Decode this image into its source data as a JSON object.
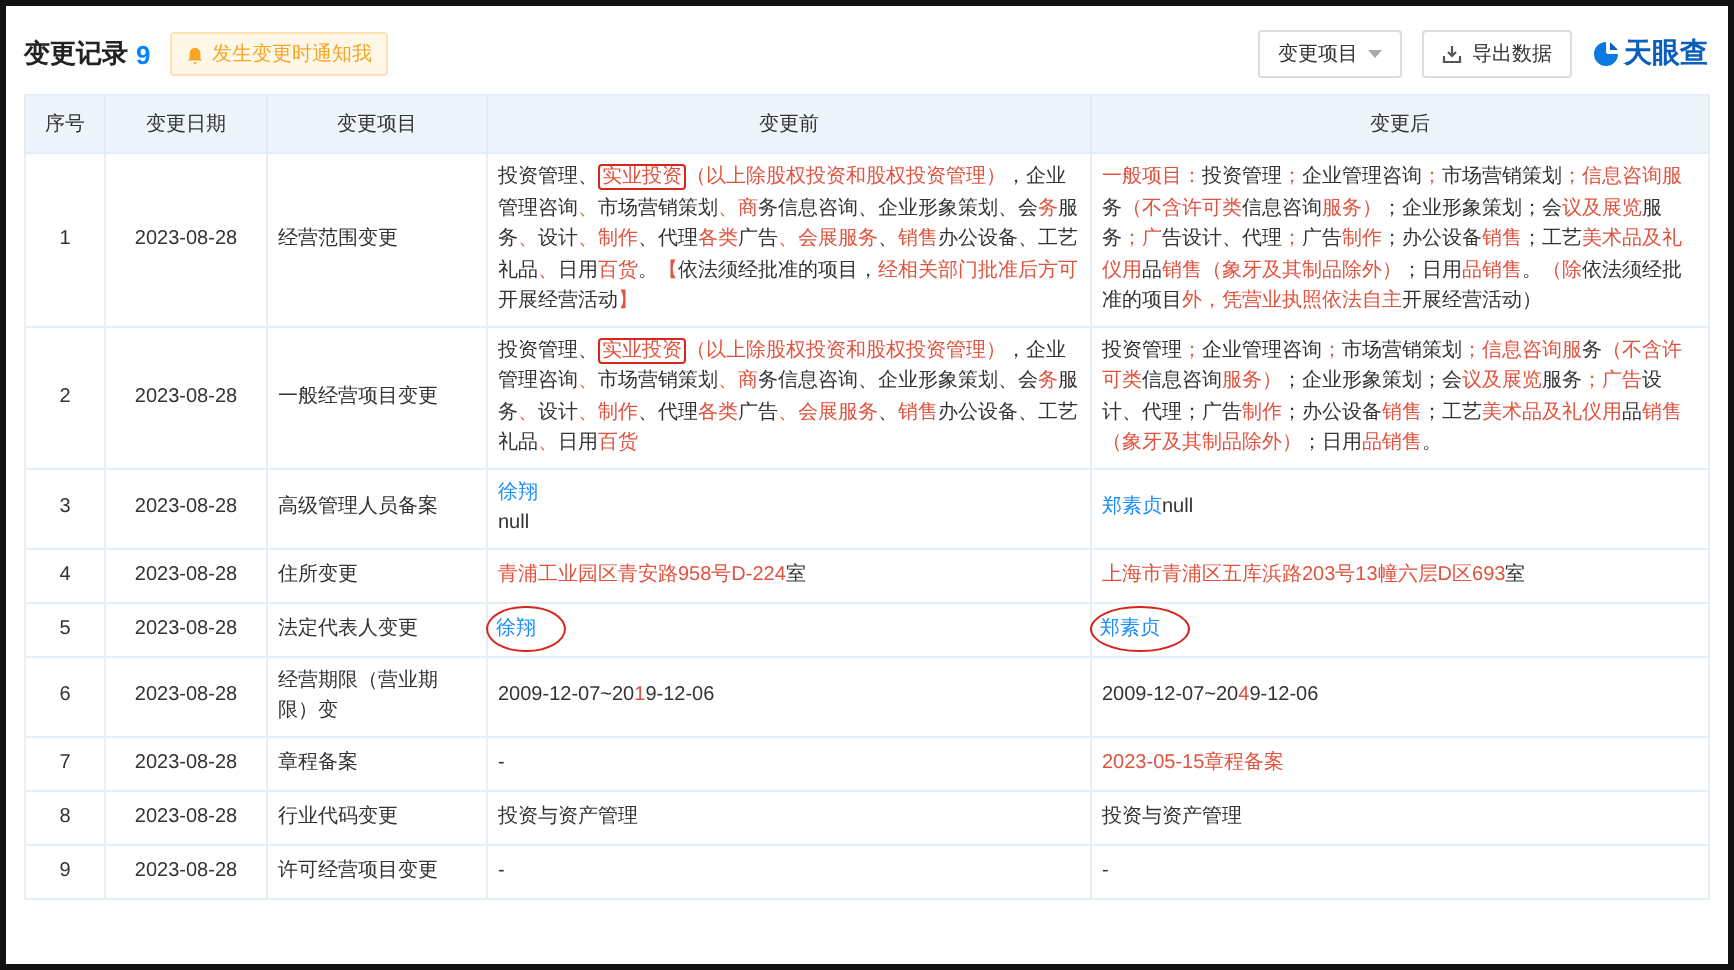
{
  "header": {
    "title": "变更记录",
    "count": "9",
    "notify_button": "发生变更时通知我",
    "filter_dropdown": "变更项目",
    "export_button": "导出数据",
    "logo": "天眼查"
  },
  "table": {
    "columns": [
      "序号",
      "变更日期",
      "变更项目",
      "变更前",
      "变更后"
    ],
    "rows": [
      {
        "index": "1",
        "date": "2023-08-28",
        "item": "经营范围变更",
        "before": [
          [
            {
              "text": "投资管理、",
              "kind": "plain"
            },
            {
              "text": "实业投资",
              "kind": "boxed"
            },
            {
              "text": "（以上除股权投资和股权投资管理）",
              "kind": "diff"
            },
            {
              "text": "，企业管理咨询",
              "kind": "plain"
            },
            {
              "text": "、",
              "kind": "diff"
            },
            {
              "text": "市场营销策划",
              "kind": "plain"
            },
            {
              "text": "、",
              "kind": "diff"
            },
            {
              "text": "商",
              "kind": "diff"
            },
            {
              "text": "务信息咨询、企业形象策划、会",
              "kind": "plain"
            },
            {
              "text": "务",
              "kind": "diff"
            },
            {
              "text": "服务",
              "kind": "plain"
            },
            {
              "text": "、",
              "kind": "diff"
            },
            {
              "text": "设计",
              "kind": "plain"
            },
            {
              "text": "、制作",
              "kind": "diff"
            },
            {
              "text": "、代理",
              "kind": "plain"
            },
            {
              "text": "各类",
              "kind": "diff"
            },
            {
              "text": "广告",
              "kind": "plain"
            },
            {
              "text": "、会展服务",
              "kind": "diff"
            },
            {
              "text": "、",
              "kind": "plain"
            },
            {
              "text": "销售",
              "kind": "diff"
            },
            {
              "text": "办公设备、工艺礼品",
              "kind": "plain"
            },
            {
              "text": "、",
              "kind": "diff"
            },
            {
              "text": "日用",
              "kind": "plain"
            },
            {
              "text": "百货",
              "kind": "diff"
            },
            {
              "text": "。",
              "kind": "plain"
            },
            {
              "text": "【",
              "kind": "diff"
            },
            {
              "text": "依法须经批准的项目，",
              "kind": "plain"
            },
            {
              "text": "经相关部门批准后方可",
              "kind": "diff"
            },
            {
              "text": "开展经营活动",
              "kind": "plain"
            },
            {
              "text": "】",
              "kind": "diff"
            }
          ]
        ],
        "after": [
          [
            {
              "text": "一般项目：",
              "kind": "diff"
            },
            {
              "text": "投资管理",
              "kind": "plain"
            },
            {
              "text": "；",
              "kind": "diff"
            },
            {
              "text": "企业管理咨询",
              "kind": "plain"
            },
            {
              "text": "；",
              "kind": "diff"
            },
            {
              "text": "市场营销策划",
              "kind": "plain"
            },
            {
              "text": "；信息咨询服",
              "kind": "diff"
            },
            {
              "text": "务",
              "kind": "plain"
            },
            {
              "text": "（不含许可类",
              "kind": "diff"
            },
            {
              "text": "信息咨询",
              "kind": "plain"
            },
            {
              "text": "服务）",
              "kind": "diff"
            },
            {
              "text": "；企业形象策划；会",
              "kind": "plain"
            },
            {
              "text": "议及展览",
              "kind": "diff"
            },
            {
              "text": "服务",
              "kind": "plain"
            },
            {
              "text": "；广",
              "kind": "diff"
            },
            {
              "text": "告设计、代理",
              "kind": "plain"
            },
            {
              "text": "；",
              "kind": "diff"
            },
            {
              "text": "广告",
              "kind": "plain"
            },
            {
              "text": "制作",
              "kind": "diff"
            },
            {
              "text": "；办公设备",
              "kind": "plain"
            },
            {
              "text": "销售",
              "kind": "diff"
            },
            {
              "text": "；工艺",
              "kind": "plain"
            },
            {
              "text": "美术品及礼仪用",
              "kind": "diff"
            },
            {
              "text": "品",
              "kind": "plain"
            },
            {
              "text": "销售（象牙及其制品除外）",
              "kind": "diff"
            },
            {
              "text": "；日用",
              "kind": "plain"
            },
            {
              "text": "品销售",
              "kind": "diff"
            },
            {
              "text": "。",
              "kind": "plain"
            },
            {
              "text": "（除",
              "kind": "diff"
            },
            {
              "text": "依法须经批准的项目",
              "kind": "plain"
            },
            {
              "text": "外，凭营业执照依法自主",
              "kind": "diff"
            },
            {
              "text": "开展经营活动）",
              "kind": "plain"
            }
          ]
        ]
      },
      {
        "index": "2",
        "date": "2023-08-28",
        "item": "一般经营项目变更",
        "before": [
          [
            {
              "text": "投资管理、",
              "kind": "plain"
            },
            {
              "text": "实业投资",
              "kind": "boxed"
            },
            {
              "text": "（以上除股权投资和股权投资管理）",
              "kind": "diff"
            },
            {
              "text": "，企业管理咨询",
              "kind": "plain"
            },
            {
              "text": "、",
              "kind": "diff"
            },
            {
              "text": "市场营销策划",
              "kind": "plain"
            },
            {
              "text": "、",
              "kind": "diff"
            },
            {
              "text": "商",
              "kind": "diff"
            },
            {
              "text": "务信息咨询、企业形象策划、会",
              "kind": "plain"
            },
            {
              "text": "务",
              "kind": "diff"
            },
            {
              "text": "服务",
              "kind": "plain"
            },
            {
              "text": "、",
              "kind": "diff"
            },
            {
              "text": "设计",
              "kind": "plain"
            },
            {
              "text": "、制作",
              "kind": "diff"
            },
            {
              "text": "、代理",
              "kind": "plain"
            },
            {
              "text": "各类",
              "kind": "diff"
            },
            {
              "text": "广告",
              "kind": "plain"
            },
            {
              "text": "、会展服务",
              "kind": "diff"
            },
            {
              "text": "、",
              "kind": "plain"
            },
            {
              "text": "销售",
              "kind": "diff"
            },
            {
              "text": "办公设备、工艺礼品",
              "kind": "plain"
            },
            {
              "text": "、",
              "kind": "diff"
            },
            {
              "text": "日用",
              "kind": "plain"
            },
            {
              "text": "百货",
              "kind": "diff"
            }
          ]
        ],
        "after": [
          [
            {
              "text": "投资管理",
              "kind": "plain"
            },
            {
              "text": "；",
              "kind": "diff"
            },
            {
              "text": "企业管理咨询",
              "kind": "plain"
            },
            {
              "text": "；",
              "kind": "diff"
            },
            {
              "text": "市场营销策划",
              "kind": "plain"
            },
            {
              "text": "；信息咨询服",
              "kind": "diff"
            },
            {
              "text": "务",
              "kind": "plain"
            },
            {
              "text": "（不含许可类",
              "kind": "diff"
            },
            {
              "text": "信息咨询",
              "kind": "plain"
            },
            {
              "text": "服务）",
              "kind": "diff"
            },
            {
              "text": "；企业形象策划；会",
              "kind": "plain"
            },
            {
              "text": "议及展览",
              "kind": "diff"
            },
            {
              "text": "服务",
              "kind": "plain"
            },
            {
              "text": "；广告",
              "kind": "diff"
            },
            {
              "text": "设计、代理；广告",
              "kind": "plain"
            },
            {
              "text": "制作",
              "kind": "diff"
            },
            {
              "text": "；办公设备",
              "kind": "plain"
            },
            {
              "text": "销售",
              "kind": "diff"
            },
            {
              "text": "；工艺",
              "kind": "plain"
            },
            {
              "text": "美术品及礼仪用",
              "kind": "diff"
            },
            {
              "text": "品",
              "kind": "plain"
            },
            {
              "text": "销售（象牙及其制品除外）",
              "kind": "diff"
            },
            {
              "text": "；日用",
              "kind": "plain"
            },
            {
              "text": "品销售",
              "kind": "diff"
            },
            {
              "text": "。",
              "kind": "plain"
            }
          ]
        ]
      },
      {
        "index": "3",
        "date": "2023-08-28",
        "item": "高级管理人员备案",
        "before": [
          [
            {
              "text": "徐翔",
              "kind": "link",
              "circled": false
            }
          ],
          [
            {
              "text": "null",
              "kind": "plain"
            }
          ]
        ],
        "after": [
          [
            {
              "text": "郑素贞",
              "kind": "link",
              "circled": false
            },
            {
              "text": "null",
              "kind": "plain"
            }
          ]
        ]
      },
      {
        "index": "4",
        "date": "2023-08-28",
        "item": "住所变更",
        "before": [
          [
            {
              "text": "青浦工业园区青安路958号D-224",
              "kind": "diff"
            },
            {
              "text": "室",
              "kind": "plain"
            }
          ]
        ],
        "after": [
          [
            {
              "text": "上海市青浦区五库浜路203号13幢六层D区693",
              "kind": "diff"
            },
            {
              "text": "室",
              "kind": "plain"
            }
          ]
        ]
      },
      {
        "index": "5",
        "date": "2023-08-28",
        "item": "法定代表人变更",
        "before": [
          [
            {
              "text": "徐翔",
              "kind": "link",
              "circled": true
            }
          ]
        ],
        "after": [
          [
            {
              "text": "郑素贞",
              "kind": "link",
              "circled": true
            }
          ]
        ]
      },
      {
        "index": "6",
        "date": "2023-08-28",
        "item": "经营期限（营业期限）变",
        "before": [
          [
            {
              "text": "2009-12-07~20",
              "kind": "plain"
            },
            {
              "text": "1",
              "kind": "diff"
            },
            {
              "text": "9-12-06",
              "kind": "plain"
            }
          ]
        ],
        "after": [
          [
            {
              "text": "2009-12-07~20",
              "kind": "plain"
            },
            {
              "text": "4",
              "kind": "diff"
            },
            {
              "text": "9-12-06",
              "kind": "plain"
            }
          ]
        ]
      },
      {
        "index": "7",
        "date": "2023-08-28",
        "item": "章程备案",
        "before": [
          [
            {
              "text": "-",
              "kind": "plain"
            }
          ]
        ],
        "after": [
          [
            {
              "text": "2023-05-15章程备案",
              "kind": "diff"
            }
          ]
        ]
      },
      {
        "index": "8",
        "date": "2023-08-28",
        "item": "行业代码变更",
        "before": [
          [
            {
              "text": "投资与资产管理",
              "kind": "plain"
            }
          ]
        ],
        "after": [
          [
            {
              "text": "投资与资产管理",
              "kind": "plain"
            }
          ]
        ]
      },
      {
        "index": "9",
        "date": "2023-08-28",
        "item": "许可经营项目变更",
        "before": [
          [
            {
              "text": "-",
              "kind": "plain"
            }
          ]
        ],
        "after": [
          [
            {
              "text": "-",
              "kind": "plain"
            }
          ]
        ]
      }
    ]
  }
}
